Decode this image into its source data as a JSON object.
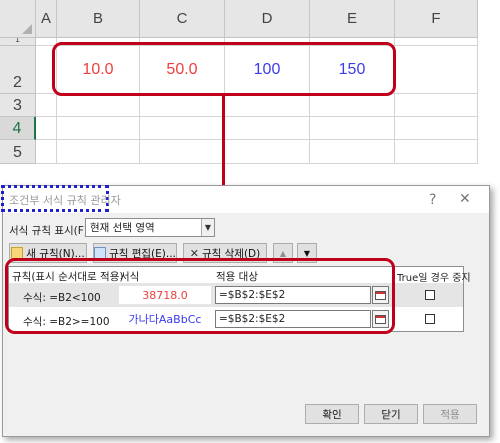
{
  "sheet": {
    "columns": [
      "A",
      "B",
      "C",
      "D",
      "E",
      "F"
    ],
    "rows": [
      "1",
      "2",
      "3",
      "4",
      "5"
    ],
    "selected_row": "4",
    "row2_values": [
      {
        "text": "10.0",
        "color": "#f03e3e"
      },
      {
        "text": "50.0",
        "color": "#f03e3e"
      },
      {
        "text": "100",
        "color": "#3b3bf0"
      },
      {
        "text": "150",
        "color": "#3b3bf0"
      }
    ]
  },
  "dialog": {
    "title": "조건부 서식 규칙 관리자",
    "help_glyph": "?",
    "close_glyph": "✕",
    "show_rules_label": "서식 규칙 표시(F):",
    "show_rules_value": "현재 선택 영역",
    "buttons": {
      "new_rule": "새 규칙(N)...",
      "edit_rule": "규칙 편집(E)...",
      "delete_rule": "규칙 삭제(D)",
      "move_up": "▲",
      "move_down": "▼"
    },
    "columns": {
      "rule": "규칙(표시 순서대로 적용)",
      "format": "서식",
      "applies_to": "적용 대상",
      "stop_if_true": "True일 경우 중지"
    },
    "rules": [
      {
        "rule": "수식: =B2<100",
        "format_preview": "38718.0",
        "format_color": "#f03e3e",
        "applies_to": "=$B$2:$E$2",
        "stop_if_true": false
      },
      {
        "rule": "수식: =B2>=100",
        "format_preview": "가나다AaBbCc",
        "format_color": "#3b3bf0",
        "applies_to": "=$B$2:$E$2",
        "stop_if_true": false
      }
    ],
    "footer": {
      "ok": "확인",
      "close": "닫기",
      "apply": "적용"
    }
  },
  "colors": {
    "highlight_red": "#c0001a",
    "dotted_blue": "#1f1fcc",
    "excel_green": "#217346"
  }
}
